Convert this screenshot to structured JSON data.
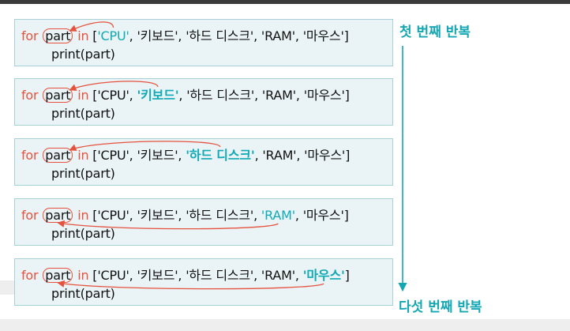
{
  "code": {
    "keyword_for": "for",
    "var": "part",
    "keyword_in": "in",
    "open": "[",
    "close": "]",
    "sep": ", ",
    "items": [
      "'CPU'",
      "'키보드'",
      "'하드 디스크'",
      "'RAM'",
      "'마우스'"
    ],
    "body": "print(part)"
  },
  "iterations": [
    0,
    1,
    2,
    3,
    4
  ],
  "labels": {
    "first": "첫 번째 반복",
    "last": "다섯 번째 반복"
  },
  "colors": {
    "keyword": "#e5533f",
    "highlight": "#10a9b5",
    "box_bg": "#eaf4f6",
    "box_border": "#a9cfd7"
  }
}
